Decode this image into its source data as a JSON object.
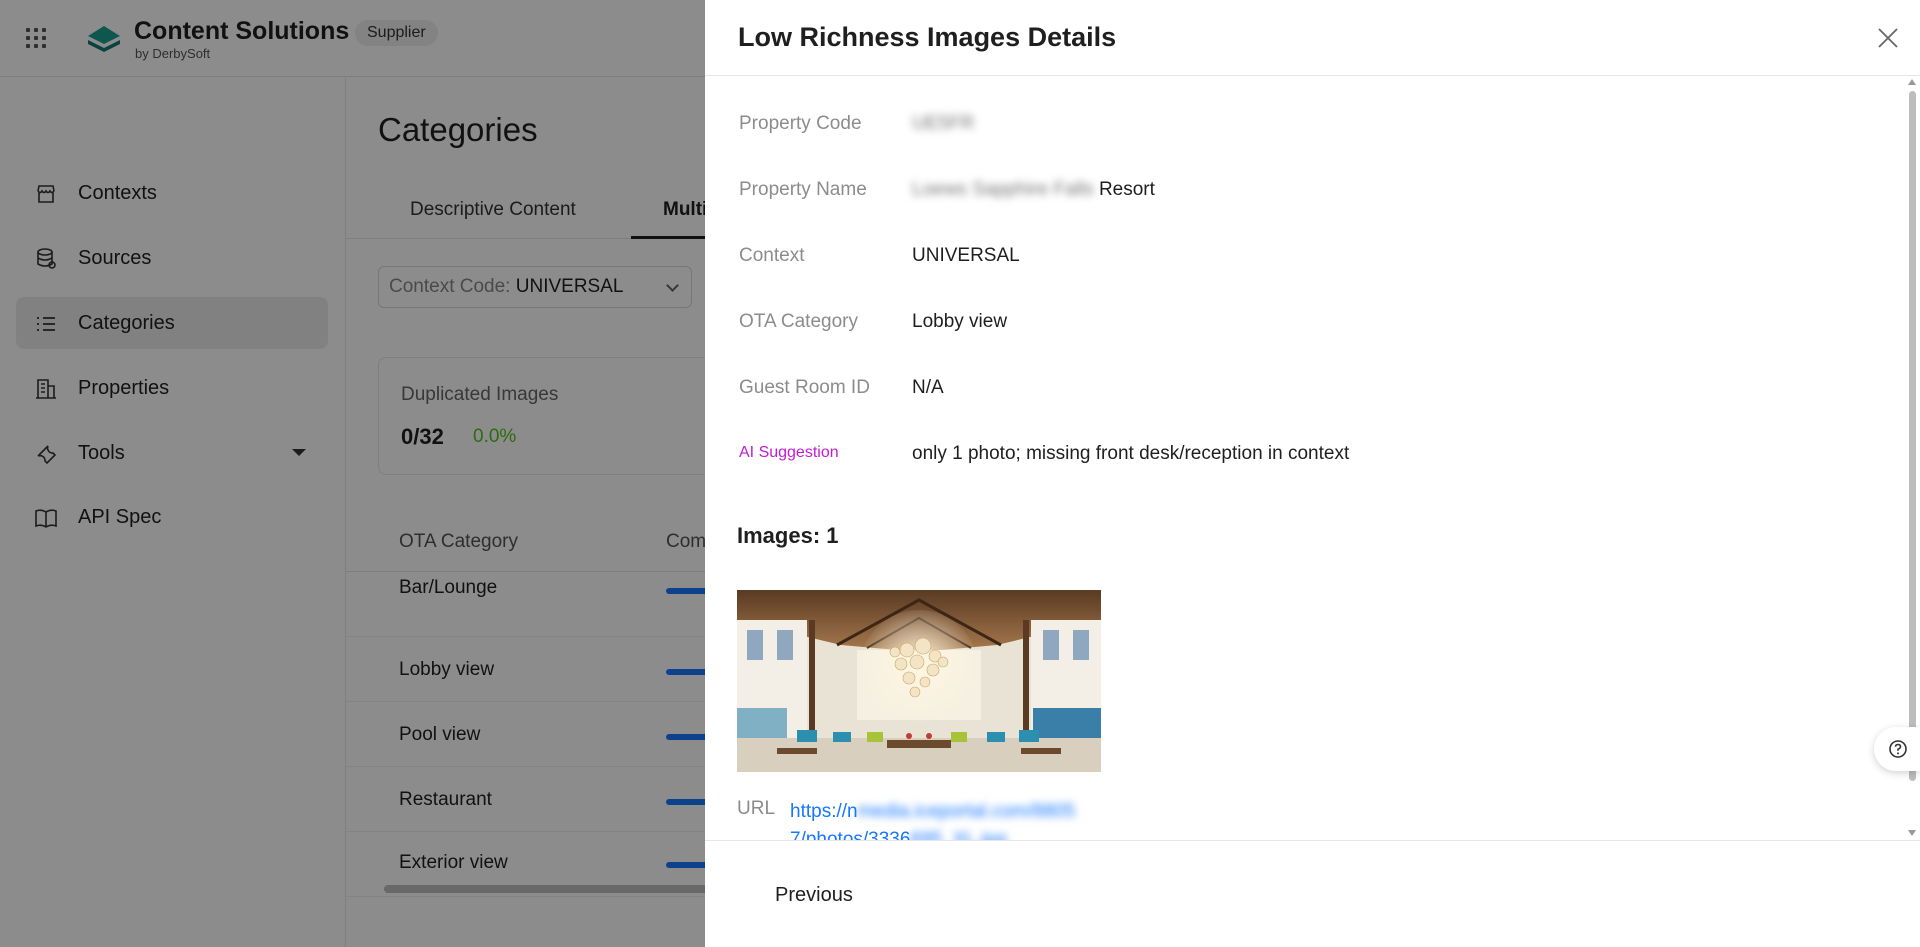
{
  "app": {
    "brand_title": "Content Solutions",
    "brand_subtitle": "by DerbySoft",
    "role_badge": "Supplier",
    "brand_color": "#1a9d8f"
  },
  "sidebar": {
    "items": [
      {
        "label": "Contexts",
        "icon": "store-icon"
      },
      {
        "label": "Sources",
        "icon": "database-icon"
      },
      {
        "label": "Categories",
        "icon": "list-icon",
        "active": true
      },
      {
        "label": "Properties",
        "icon": "building-icon"
      },
      {
        "label": "Tools",
        "icon": "wrench-icon",
        "has_submenu": true
      },
      {
        "label": "API Spec",
        "icon": "book-icon"
      }
    ]
  },
  "main": {
    "page_title": "Categories",
    "tabs": [
      {
        "label": "Descriptive Content"
      },
      {
        "label": "Multi",
        "active": true
      }
    ],
    "context_select": {
      "label": "Context Code:",
      "value": "UNIVERSAL"
    },
    "duplicated_card": {
      "title": "Duplicated Images",
      "count": "0/32",
      "percent": "0.0%"
    },
    "table": {
      "headers": [
        "OTA Category",
        "Com"
      ],
      "rows": [
        {
          "category": "Bar/Lounge"
        },
        {
          "category": "Lobby view"
        },
        {
          "category": "Pool view"
        },
        {
          "category": "Restaurant"
        },
        {
          "category": "Exterior view"
        }
      ]
    }
  },
  "drawer": {
    "title": "Low Richness Images Details",
    "details": {
      "property_code_label": "Property Code",
      "property_code_value": "UE5FR",
      "property_name_label": "Property Name",
      "property_name_blurred": "Loews Sapphire Falls",
      "property_name_visible": "Resort",
      "context_label": "Context",
      "context_value": "UNIVERSAL",
      "ota_category_label": "OTA Category",
      "ota_category_value": "Lobby view",
      "guest_room_label": "Guest Room ID",
      "guest_room_value": "N/A",
      "ai_label": "AI Suggestion",
      "ai_value": "only 1 photo; missing front desk/reception in context"
    },
    "images_title": "Images: 1",
    "url_label": "URL",
    "url_line1_visible": "https://n",
    "url_line1_blurred": "media.iceportal.com/8805",
    "url_line2_visible": "7/photos/3336",
    "url_line2_blurred": "695_XL.jpg",
    "footer": {
      "previous_label": "Previous"
    },
    "ai_color": "#c21bd6",
    "link_color": "#1677ff"
  }
}
